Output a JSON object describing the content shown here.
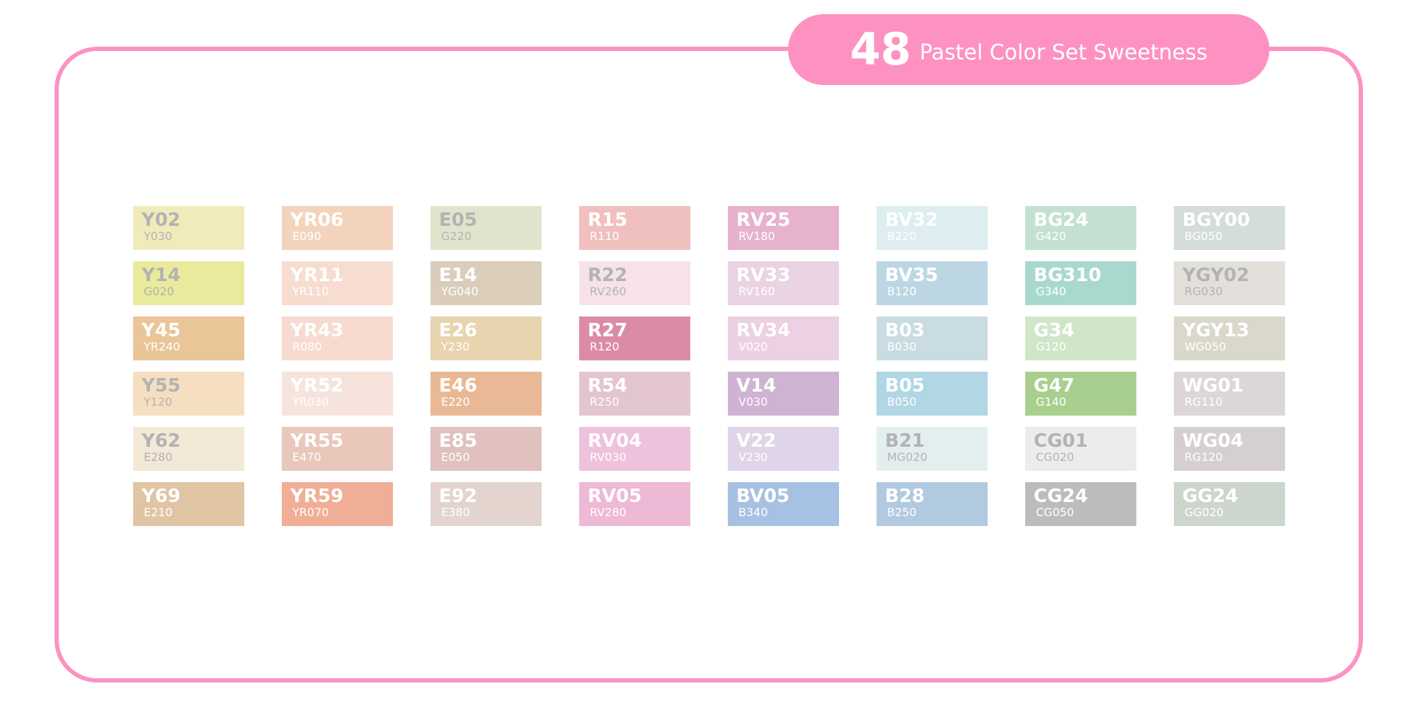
{
  "title": {
    "number": "48",
    "text": "Pastel Color Set Sweetness"
  },
  "colors": {
    "frame": "#fd92c2",
    "pill": "#fd92c2"
  },
  "columns": [
    [
      {
        "code": "Y02",
        "sub": "Y030",
        "color": "#f1ebbb",
        "text": "gray"
      },
      {
        "code": "Y14",
        "sub": "G020",
        "color": "#e9ea9c",
        "text": "gray"
      },
      {
        "code": "Y45",
        "sub": "YR240",
        "color": "#eac597",
        "text": "white"
      },
      {
        "code": "Y55",
        "sub": "Y120",
        "color": "#f6dfc0",
        "text": "gray"
      },
      {
        "code": "Y62",
        "sub": "E280",
        "color": "#f4e8d6",
        "text": "gray"
      },
      {
        "code": "Y69",
        "sub": "E210",
        "color": "#dfc5a4",
        "text": "white"
      }
    ],
    [
      {
        "code": "YR06",
        "sub": "E090",
        "color": "#f4d3bd",
        "text": "white"
      },
      {
        "code": "YR11",
        "sub": "YR110",
        "color": "#f6ddd0",
        "text": "white"
      },
      {
        "code": "YR43",
        "sub": "R080",
        "color": "#f7dbd0",
        "text": "white"
      },
      {
        "code": "YR52",
        "sub": "YR030",
        "color": "#f6e4dc",
        "text": "white"
      },
      {
        "code": "YR55",
        "sub": "E470",
        "color": "#e9c7bb",
        "text": "white"
      },
      {
        "code": "YR59",
        "sub": "YR070",
        "color": "#f0ae96",
        "text": "white"
      }
    ],
    [
      {
        "code": "E05",
        "sub": "G220",
        "color": "#e2e3cc",
        "text": "gray"
      },
      {
        "code": "E14",
        "sub": "YG040",
        "color": "#dacebb",
        "text": "white"
      },
      {
        "code": "E26",
        "sub": "Y230",
        "color": "#e9d4b0",
        "text": "white"
      },
      {
        "code": "E46",
        "sub": "E220",
        "color": "#e9b995",
        "text": "white"
      },
      {
        "code": "E85",
        "sub": "E050",
        "color": "#e1c1bd",
        "text": "white"
      },
      {
        "code": "E92",
        "sub": "E380",
        "color": "#e3d4ce",
        "text": "white"
      }
    ],
    [
      {
        "code": "R15",
        "sub": "R110",
        "color": "#f0c0be",
        "text": "white"
      },
      {
        "code": "R22",
        "sub": "RV260",
        "color": "#f7e3e7",
        "text": "gray"
      },
      {
        "code": "R27",
        "sub": "R120",
        "color": "#db8ba7",
        "text": "white"
      },
      {
        "code": "R54",
        "sub": "R250",
        "color": "#e3c5cf",
        "text": "white"
      },
      {
        "code": "RV04",
        "sub": "RV030",
        "color": "#eec1dc",
        "text": "white"
      },
      {
        "code": "RV05",
        "sub": "RV280",
        "color": "#eeb9d6",
        "text": "white"
      }
    ],
    [
      {
        "code": "RV25",
        "sub": "RV180",
        "color": "#e7b2cd",
        "text": "white"
      },
      {
        "code": "RV33",
        "sub": "RV160",
        "color": "#ead3e3",
        "text": "white"
      },
      {
        "code": "RV34",
        "sub": "V020",
        "color": "#ecd0e3",
        "text": "white"
      },
      {
        "code": "V14",
        "sub": "V030",
        "color": "#ceb3d2",
        "text": "white"
      },
      {
        "code": "V22",
        "sub": "V230",
        "color": "#e0d5e8",
        "text": "white"
      },
      {
        "code": "BV05",
        "sub": "B340",
        "color": "#a7c1e2",
        "text": "white"
      }
    ],
    [
      {
        "code": "BV32",
        "sub": "B220",
        "color": "#ddedf0",
        "text": "white"
      },
      {
        "code": "BV35",
        "sub": "B120",
        "color": "#bcd7e3",
        "text": "white"
      },
      {
        "code": "B03",
        "sub": "B030",
        "color": "#c9dce2",
        "text": "white"
      },
      {
        "code": "B05",
        "sub": "B050",
        "color": "#b1d6e4",
        "text": "white"
      },
      {
        "code": "B21",
        "sub": "MG020",
        "color": "#e3efee",
        "text": "gray"
      },
      {
        "code": "B28",
        "sub": "B250",
        "color": "#b1cae0",
        "text": "white"
      }
    ],
    [
      {
        "code": "BG24",
        "sub": "G420",
        "color": "#c4e0d3",
        "text": "white"
      },
      {
        "code": "BG310",
        "sub": "G340",
        "color": "#a9d9ce",
        "text": "white"
      },
      {
        "code": "G34",
        "sub": "G120",
        "color": "#cfe6c8",
        "text": "white"
      },
      {
        "code": "G47",
        "sub": "G140",
        "color": "#a9cf8f",
        "text": "white"
      },
      {
        "code": "CG01",
        "sub": "CG020",
        "color": "#ececec",
        "text": "gray"
      },
      {
        "code": "CG24",
        "sub": "CG050",
        "color": "#bbbdbb",
        "text": "white"
      }
    ],
    [
      {
        "code": "BGY00",
        "sub": "BG050",
        "color": "#d4dddb",
        "text": "white"
      },
      {
        "code": "YGY02",
        "sub": "RG030",
        "color": "#e3e0db",
        "text": "gray"
      },
      {
        "code": "YGY13",
        "sub": "WG050",
        "color": "#d9d8cb",
        "text": "white"
      },
      {
        "code": "WG01",
        "sub": "RG110",
        "color": "#dcd6db",
        "text": "white"
      },
      {
        "code": "WG04",
        "sub": "RG120",
        "color": "#d5cfd3",
        "text": "white"
      },
      {
        "code": "GG24",
        "sub": "GG020",
        "color": "#cdd6cc",
        "text": "white"
      }
    ]
  ]
}
